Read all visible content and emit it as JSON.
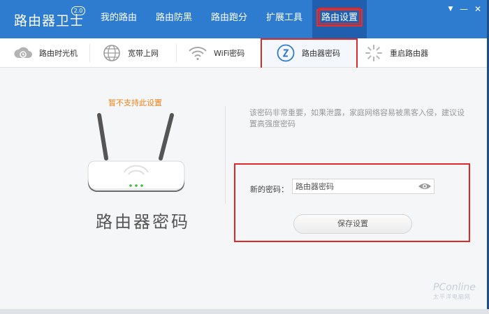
{
  "app": {
    "title": "路由器卫士",
    "version": "2.0"
  },
  "nav": {
    "tabs": [
      {
        "label": "我的路由"
      },
      {
        "label": "路由防黑"
      },
      {
        "label": "路由跑分"
      },
      {
        "label": "扩展工具"
      },
      {
        "label": "路由设置",
        "active": true
      }
    ]
  },
  "window_controls": {
    "menu": "▼",
    "minimize": "—",
    "close": "✕"
  },
  "subnav": {
    "items": [
      {
        "label": "路由时光机",
        "icon": "cloud-icon"
      },
      {
        "label": "宽带上网",
        "icon": "globe-icon"
      },
      {
        "label": "WiFi密码",
        "icon": "wifi-icon"
      },
      {
        "label": "路由器密码",
        "icon": "lock-icon",
        "active": true
      },
      {
        "label": "重启路由器",
        "icon": "restart-icon"
      }
    ]
  },
  "main": {
    "notice": "暂不支持此设置",
    "heading": "路由器密码",
    "hint": "该密码非常重要，如果泄露，家庭网络容易被黑客入侵，建议设置高强度密码",
    "form": {
      "password_label": "新的密码：",
      "password_value": "路由器密码",
      "save_label": "保存设置"
    }
  },
  "watermark": {
    "brand": "PConline",
    "tagline": "太平洋电脑网"
  },
  "colors": {
    "header": "#2e7ccf",
    "active_tab": "#1f5fae",
    "highlight": "#e02926",
    "notice": "#f08219"
  }
}
